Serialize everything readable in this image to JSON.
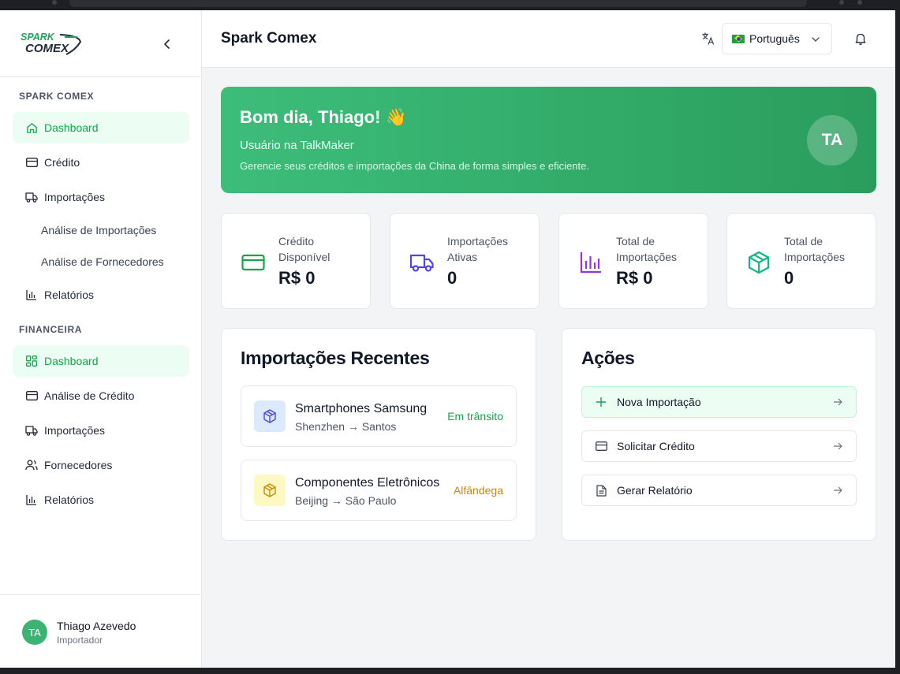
{
  "app": {
    "title": "Spark Comex",
    "logo_text_top": "SPARK",
    "logo_text_bottom": "COMEX"
  },
  "sidebar": {
    "sections": [
      {
        "title": "SPARK COMEX",
        "items": [
          {
            "label": "Dashboard",
            "icon": "home-icon",
            "active": true
          },
          {
            "label": "Crédito",
            "icon": "credit-card-icon"
          },
          {
            "label": "Importações",
            "icon": "truck-icon"
          },
          {
            "label": "Análise de Importações",
            "sub": true
          },
          {
            "label": "Análise de Fornecedores",
            "sub": true
          },
          {
            "label": "Relatórios",
            "icon": "bar-chart-icon"
          }
        ]
      },
      {
        "title": "FINANCEIRA",
        "items": [
          {
            "label": "Dashboard",
            "icon": "layout-grid-icon",
            "active": true
          },
          {
            "label": "Análise de Crédito",
            "icon": "credit-card-icon"
          },
          {
            "label": "Importações",
            "icon": "truck-icon"
          },
          {
            "label": "Fornecedores",
            "icon": "users-icon"
          },
          {
            "label": "Relatórios",
            "icon": "bar-chart-icon"
          }
        ]
      }
    ],
    "user": {
      "initials": "TA",
      "name": "Thiago Azevedo",
      "role": "Importador"
    }
  },
  "header": {
    "title": "Spark Comex",
    "language": "Português"
  },
  "welcome": {
    "greeting": "Bom dia, Thiago! 👋",
    "subtitle": "Usuário na TalkMaker",
    "description": "Gerencie seus créditos e importações da China de forma simples e eficiente.",
    "initials": "TA"
  },
  "stats": [
    {
      "label": "Crédito Disponível",
      "value": "R$ 0",
      "icon": "credit-card-icon",
      "color": "#16a34a"
    },
    {
      "label": "Importações Ativas",
      "value": "0",
      "icon": "truck-icon",
      "color": "#4f46e5"
    },
    {
      "label": "Total de Importações",
      "value": "R$ 0",
      "icon": "bar-chart-icon",
      "color": "#9333ea"
    },
    {
      "label": "Total de Importações",
      "value": "0",
      "icon": "package-icon",
      "color": "#10b981"
    }
  ],
  "recent_imports": {
    "title": "Importações Recentes",
    "items": [
      {
        "name": "Smartphones Samsung",
        "route": "Shenzhen → Santos",
        "status": "Em trânsito",
        "status_color": "#16a34a",
        "icon_bg": "#dbeafe",
        "icon_color": "#4f46e5"
      },
      {
        "name": "Componentes Eletrônicos",
        "route": "Beijing → São Paulo",
        "status": "Alfândega",
        "status_color": "#ca8a04",
        "icon_bg": "#fef9c3",
        "icon_color": "#ca8a04"
      }
    ]
  },
  "actions": {
    "title": "Ações",
    "items": [
      {
        "label": "Nova Importação",
        "icon": "plus-icon"
      },
      {
        "label": "Solicitar Crédito",
        "icon": "credit-card-icon"
      },
      {
        "label": "Gerar Relatório",
        "icon": "file-text-icon"
      }
    ]
  }
}
